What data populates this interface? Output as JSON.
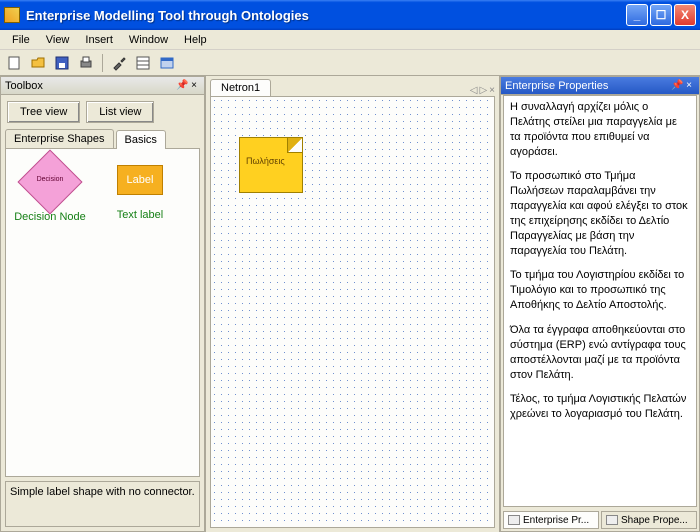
{
  "window": {
    "title": "Enterprise Modelling Tool through Ontologies"
  },
  "menu": {
    "file": "File",
    "view": "View",
    "insert": "Insert",
    "window": "Window",
    "help": "Help"
  },
  "toolbox": {
    "title": "Toolbox",
    "tree_btn": "Tree view",
    "list_btn": "List view",
    "tab1": "Enterprise Shapes",
    "tab2": "Basics",
    "shape1_inner": "Decision",
    "shape1_label": "Decision Node",
    "shape2_inner": "Label",
    "shape2_label": "Text label",
    "description": "Simple label shape with no connector."
  },
  "canvas": {
    "doc_tab": "Netron1",
    "sticky_label": "Πωλήσεις"
  },
  "props": {
    "title": "Enterprise Properties",
    "p1": "Η συναλλαγή αρχίζει μόλις ο Πελάτης στείλει μια παραγγελία με τα προϊόντα που επιθυμεί να αγοράσει.",
    "p2": "Το προσωπικό στο Τμήμα Πωλήσεων παραλαμβάνει την παραγγελία και αφού ελέγξει το στοκ της επιχείρησης εκδίδει το Δελτίο Παραγγελίας με βάση την παραγγελία του Πελάτη.",
    "p3": "Το τμήμα του Λογιστηρίου εκδίδει το Τιμολόγιο και το προσωπικό της Αποθήκης το Δελτίο Αποστολής.",
    "p4": " Όλα τα έγγραφα αποθηκεύονται στο σύστημα (ERP) ενώ αντίγραφα τους αποστέλλονται μαζί με τα προϊόντα στον Πελάτη.",
    "p5": "Τέλος, το τμήμα Λογιστικής Πελατών χρεώνει το λογαριασμό του Πελάτη.",
    "tab1": "Enterprise Pr...",
    "tab2": "Shape Prope..."
  }
}
